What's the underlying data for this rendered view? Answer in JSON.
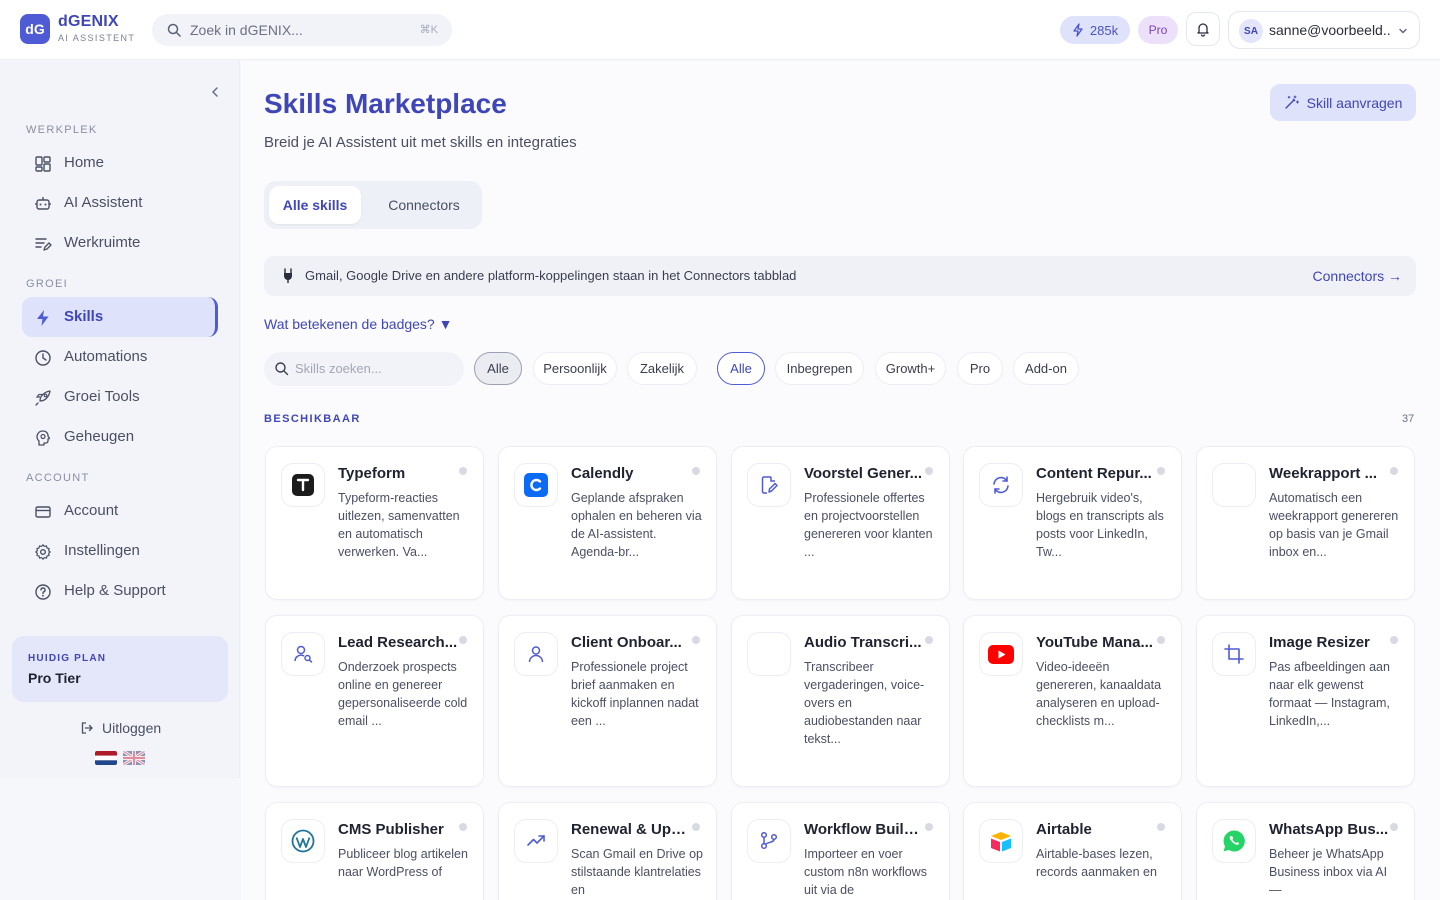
{
  "brand": {
    "logo_text": "dG",
    "name": "dGENIX",
    "subtitle": "AI ASSISTENT"
  },
  "topbar": {
    "search_placeholder": "Zoek in dGENIX...",
    "search_shortcut": "⌘K",
    "credits": "285k",
    "plan_badge": "Pro",
    "user_initials": "SA",
    "user_email": "sanne@voorbeeld..."
  },
  "sidebar": {
    "sections": [
      {
        "label": "WERKPLEK",
        "items": [
          {
            "label": "Home",
            "icon": "dashboard-icon"
          },
          {
            "label": "AI Assistent",
            "icon": "robot-icon"
          },
          {
            "label": "Werkruimte",
            "icon": "workspace-icon"
          }
        ]
      },
      {
        "label": "GROEI",
        "items": [
          {
            "label": "Skills",
            "icon": "lightning-icon",
            "active": true
          },
          {
            "label": "Automations",
            "icon": "clock-icon"
          },
          {
            "label": "Groei Tools",
            "icon": "rocket-icon"
          },
          {
            "label": "Geheugen",
            "icon": "brain-icon"
          }
        ]
      },
      {
        "label": "ACCOUNT",
        "items": [
          {
            "label": "Account",
            "icon": "card-icon"
          },
          {
            "label": "Instellingen",
            "icon": "gear-icon"
          },
          {
            "label": "Help & Support",
            "icon": "help-icon"
          }
        ]
      }
    ],
    "plan_label": "HUIDIG PLAN",
    "plan_value": "Pro Tier",
    "logout": "Uitloggen"
  },
  "main": {
    "title": "Skills Marketplace",
    "subtitle": "Breid je AI Assistent uit met skills en integraties",
    "request_button": "Skill aanvragen",
    "tabs": [
      "Alle skills",
      "Connectors"
    ],
    "notice_text": "Gmail, Google Drive en andere platform-koppelingen staan in het Connectors tabblad",
    "notice_link": "Connectors →",
    "badges_link": "Wat betekenen de badges? ▼",
    "skills_search_placeholder": "Skills zoeken...",
    "filters_type": [
      "Alle",
      "Persoonlijk",
      "Zakelijk"
    ],
    "filters_tier": [
      "Alle",
      "Inbegrepen",
      "Growth+",
      "Pro",
      "Add-on"
    ],
    "section_label": "BESCHIKBAAR",
    "count": "37",
    "skills": [
      {
        "name": "Typeform",
        "desc": "Typeform-reacties uitlezen, samenvatten en automatisch verwerken. Va...",
        "icon": "typeform-icon"
      },
      {
        "name": "Calendly",
        "desc": "Geplande afspraken ophalen en beheren via de AI-assistent. Agenda-br...",
        "icon": "calendly-icon"
      },
      {
        "name": "Voorstel Gener...",
        "desc": "Professionele offertes en projectvoorstellen genereren voor klanten ...",
        "icon": "document-edit-icon"
      },
      {
        "name": "Content Repur...",
        "desc": "Hergebruik video's, blogs en transcripts als posts voor LinkedIn, Tw...",
        "icon": "refresh-icon"
      },
      {
        "name": "Weekrapport ...",
        "desc": "Automatisch een weekrapport genereren op basis van je Gmail inbox en...",
        "icon": "blank-icon"
      },
      {
        "name": "Lead Research...",
        "desc": "Onderzoek prospects online en genereer gepersonaliseerde cold email ...",
        "icon": "user-search-icon"
      },
      {
        "name": "Client Onboar...",
        "desc": "Professionele project brief aanmaken en kickoff inplannen nadat een ...",
        "icon": "user-icon"
      },
      {
        "name": "Audio Transcri...",
        "desc": "Transcribeer vergaderingen, voice-overs en audiobestanden naar tekst...",
        "icon": "blank-icon"
      },
      {
        "name": "YouTube Mana...",
        "desc": "Video-ideeën genereren, kanaaldata analyseren en upload-checklists m...",
        "icon": "youtube-icon"
      },
      {
        "name": "Image Resizer",
        "desc": "Pas afbeeldingen aan naar elk gewenst formaat — Instagram, LinkedIn,...",
        "icon": "crop-icon"
      },
      {
        "name": "CMS Publisher",
        "desc": "Publiceer blog artikelen naar WordPress of",
        "icon": "wordpress-icon"
      },
      {
        "name": "Renewal & Ups...",
        "desc": "Scan Gmail en Drive op stilstaande klantrelaties en",
        "icon": "trending-up-icon"
      },
      {
        "name": "Workflow Build...",
        "desc": "Importeer en voer custom n8n workflows uit via de",
        "icon": "git-branch-icon"
      },
      {
        "name": "Airtable",
        "desc": "Airtable-bases lezen, records aanmaken en",
        "icon": "airtable-icon"
      },
      {
        "name": "WhatsApp Bus...",
        "desc": "Beheer je WhatsApp Business inbox via AI —",
        "icon": "whatsapp-icon"
      }
    ]
  },
  "colors": {
    "accent": "#4f5bd5",
    "accent_text": "#3f47b8",
    "accent_soft": "#dfe2fb"
  }
}
